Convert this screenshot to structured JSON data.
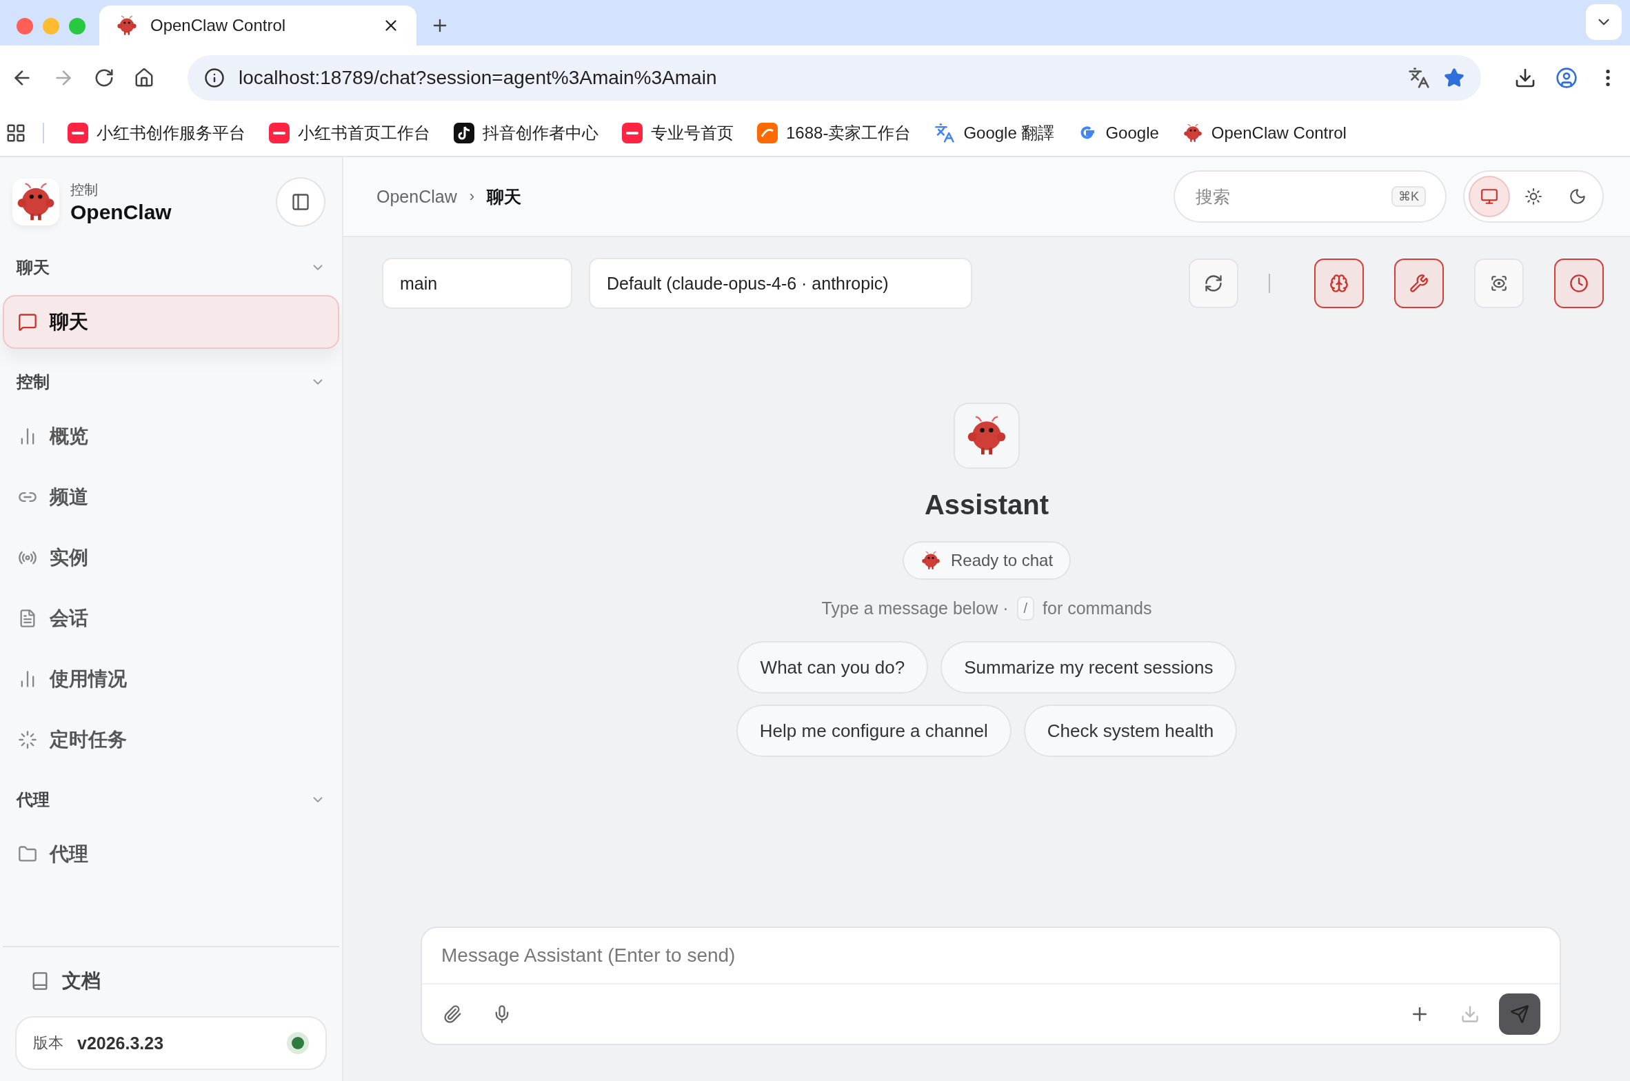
{
  "browser": {
    "tabs": [
      {
        "title": "OpenClaw Control",
        "selected": true
      }
    ],
    "url": "localhost:18789/chat?session=agent%3Amain%3Amain",
    "bookmarked": true,
    "bookmarks": [
      {
        "kind": "xhs",
        "label": "小红书创作服务平台"
      },
      {
        "kind": "xhs",
        "label": "小红书首页工作台"
      },
      {
        "kind": "douyin",
        "label": "抖音创作者中心"
      },
      {
        "kind": "xhs",
        "label": "专业号首页"
      },
      {
        "kind": "alibaba",
        "label": "1688-卖家工作台"
      },
      {
        "kind": "translate",
        "label": "Google 翻譯"
      },
      {
        "kind": "google",
        "label": "Google"
      },
      {
        "kind": "openclaw",
        "label": "OpenClaw Control"
      }
    ]
  },
  "sidebar": {
    "brand": {
      "subtitle": "控制",
      "title": "OpenClaw"
    },
    "groups": [
      {
        "label": "聊天",
        "expanded": true,
        "items": [
          {
            "kind": "chat",
            "label": "聊天",
            "selected": true
          }
        ]
      },
      {
        "label": "控制",
        "expanded": true,
        "items": [
          {
            "kind": "bars",
            "label": "概览",
            "selected": false
          },
          {
            "kind": "link",
            "label": "频道",
            "selected": false
          },
          {
            "kind": "radio",
            "label": "实例",
            "selected": false
          },
          {
            "kind": "file",
            "label": "会话",
            "selected": false
          },
          {
            "kind": "bars",
            "label": "使用情况",
            "selected": false
          },
          {
            "kind": "loader",
            "label": "定时任务",
            "selected": false
          }
        ]
      },
      {
        "label": "代理",
        "expanded": true,
        "items": [
          {
            "kind": "folder",
            "label": "代理",
            "selected": false
          }
        ]
      }
    ],
    "docs": "文档",
    "version": {
      "label": "版本",
      "value": "v2026.3.23",
      "color": "#2e7d3e"
    }
  },
  "header": {
    "breadcrumb": [
      "OpenClaw",
      "聊天"
    ],
    "breadcrumb_separator": "›",
    "search": {
      "placeholder": "搜索",
      "shortcut": "⌘K"
    },
    "themes": [
      {
        "kind": "system",
        "selected": true
      },
      {
        "kind": "light",
        "selected": false
      },
      {
        "kind": "dark",
        "selected": false
      }
    ]
  },
  "toolbar": {
    "session": "main",
    "model": "Default (claude-opus-4-6 · anthropic)",
    "actions": [
      {
        "kind": "refresh",
        "active": false
      },
      {
        "kind": "brain",
        "active": true
      },
      {
        "kind": "wrench",
        "active": true
      },
      {
        "kind": "focus",
        "active": false
      },
      {
        "kind": "clock",
        "active": true
      }
    ]
  },
  "welcome": {
    "title": "Assistant",
    "status": "Ready to chat",
    "hint_before": "Type a message below ·",
    "hint_key": "/",
    "hint_after": "for commands",
    "suggestions": [
      "What can you do?",
      "Summarize my recent sessions",
      "Help me configure a channel",
      "Check system health"
    ]
  },
  "composer": {
    "placeholder": "Message Assistant (Enter to send)"
  }
}
